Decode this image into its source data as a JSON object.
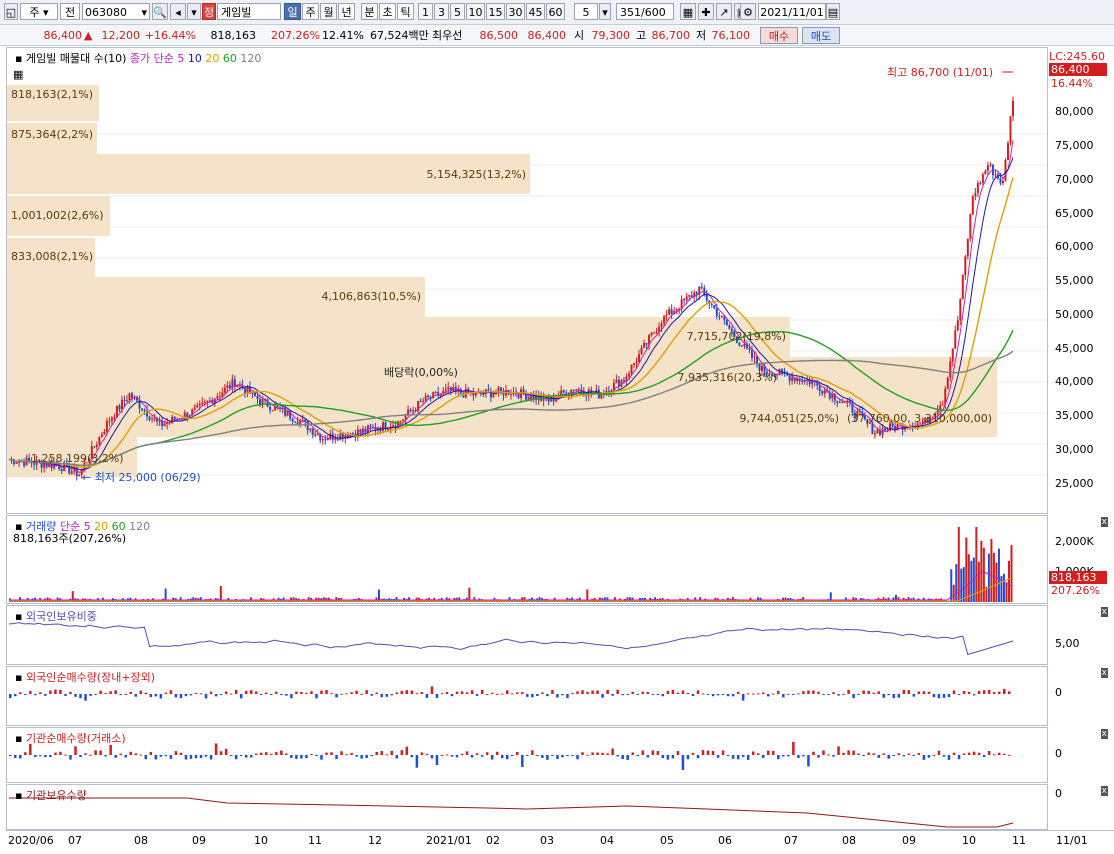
{
  "toolbar": {
    "period_label": "주",
    "prev_label": "전",
    "code_value": "063080",
    "stock_name": "게임빌",
    "tab_day": "일",
    "tab_week": "주",
    "tab_month": "월",
    "tab_year": "년",
    "tab_min": "분",
    "tab_sec": "초",
    "tab_tick": "틱",
    "interval_options": [
      "1",
      "3",
      "5",
      "10",
      "15",
      "30",
      "45",
      "60"
    ],
    "interval_value": "5",
    "count_value": "351",
    "count_total": "/600",
    "date_value": "2021/11/01"
  },
  "info": {
    "price": "86,400",
    "change": "12,200",
    "change_pct": "+16.44%",
    "volume": "818,163",
    "volume_ratio": "207.26%",
    "turnover": "12.41%",
    "amount": "67,524백만",
    "best_label": "최우선",
    "ask": "86,500",
    "bid": "86,400",
    "open_label": "시",
    "open": "79,300",
    "high_label": "고",
    "high": "86,700",
    "low_label": "저",
    "low": "76,100",
    "buy_label": "매수",
    "sell_label": "매도"
  },
  "price_pane": {
    "title": "게임빌 매물대 수(10)",
    "ma_label": "종가 단순",
    "ma_periods": [
      "5",
      "10",
      "20",
      "60",
      "120"
    ],
    "lc_label": "LC:245.60",
    "last_price": "86,400",
    "last_pct": "16.44%",
    "high_annotation": "최고 86,700 (11/01)",
    "low_annotation": "최저 25,000 (06/29)",
    "dividend_label": "배당락(0,00%)",
    "volume_profile": [
      {
        "label": "818,163(2,1%)"
      },
      {
        "label": "875,364(2,2%)"
      },
      {
        "label": "5,154,325(13,2%)"
      },
      {
        "label": "1,001,002(2,6%)"
      },
      {
        "label": "833,008(2,1%)"
      },
      {
        "label": "4,106,863(10,5%)"
      },
      {
        "label": "7,715,702(19,8%)"
      },
      {
        "label": "7,935,316(20,3%)"
      },
      {
        "label": "9,744,051(25,0%)"
      },
      {
        "label": "(37,760,00,  3,310,000,00)"
      },
      {
        "label": "1,258,199(3,2%)"
      }
    ],
    "y_ticks": [
      "80,000",
      "75,000",
      "70,000",
      "65,000",
      "60,000",
      "55,000",
      "50,000",
      "45,000",
      "40,000",
      "35,000",
      "30,000",
      "25,000"
    ]
  },
  "volume_pane": {
    "title": "거래량",
    "ma_label": "단순",
    "ma_periods": [
      "5",
      "20",
      "60",
      "120"
    ],
    "value_label": "818,163주(207,26%)",
    "y_ticks": [
      "2,000K",
      "1,000K"
    ],
    "last_value": "818,163",
    "last_pct": "207.26%"
  },
  "foreign_ratio_pane": {
    "title": "외국인보유비중",
    "y_tick": "5,00"
  },
  "foreign_net_pane": {
    "title": "외국인순매수량(장내+장외)",
    "y_tick": "0"
  },
  "inst_net_pane": {
    "title": "기관순매수량(거래소)",
    "y_tick": "0"
  },
  "inst_hold_pane": {
    "title": "기관보유수량",
    "y_tick": "0"
  },
  "x_axis": [
    "2020/06",
    "07",
    "08",
    "09",
    "10",
    "11",
    "12",
    "2021/01",
    "02",
    "03",
    "04",
    "05",
    "06",
    "07",
    "08",
    "09",
    "10",
    "11",
    "11/01"
  ],
  "colors": {
    "up": "#d21e1e",
    "down": "#1e4fd2",
    "ma5": "#c020c0",
    "ma10": "#1a1aa0",
    "ma20": "#e0a000",
    "ma60": "#20a020",
    "ma120": "#808080",
    "volume_profile": "#f6e6d0"
  }
}
